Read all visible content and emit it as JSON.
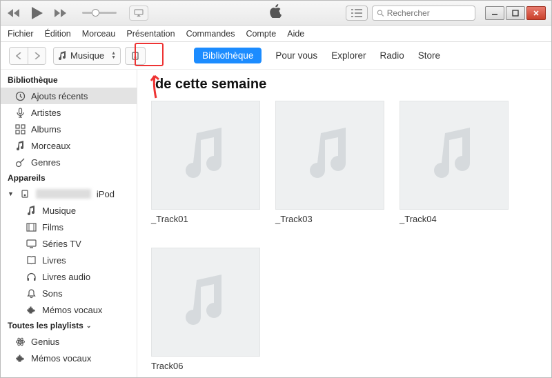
{
  "search": {
    "placeholder": "Rechercher"
  },
  "menubar": [
    "Fichier",
    "Édition",
    "Morceau",
    "Présentation",
    "Commandes",
    "Compte",
    "Aide"
  ],
  "subbar": {
    "media_label": "Musique"
  },
  "tabs": [
    {
      "label": "Bibliothèque",
      "active": true
    },
    {
      "label": "Pour vous",
      "active": false
    },
    {
      "label": "Explorer",
      "active": false
    },
    {
      "label": "Radio",
      "active": false
    },
    {
      "label": "Store",
      "active": false
    }
  ],
  "sidebar": {
    "library_header": "Bibliothèque",
    "library_items": [
      {
        "icon": "clock",
        "label": "Ajouts récents",
        "selected": true
      },
      {
        "icon": "mic",
        "label": "Artistes"
      },
      {
        "icon": "grid",
        "label": "Albums"
      },
      {
        "icon": "note",
        "label": "Morceaux"
      },
      {
        "icon": "guitar",
        "label": "Genres"
      }
    ],
    "devices_header": "Appareils",
    "device_name_suffix": "iPod",
    "device_items": [
      {
        "icon": "note",
        "label": "Musique"
      },
      {
        "icon": "film",
        "label": "Films"
      },
      {
        "icon": "tv",
        "label": "Séries TV"
      },
      {
        "icon": "book",
        "label": "Livres"
      },
      {
        "icon": "headphones",
        "label": "Livres audio"
      },
      {
        "icon": "bell",
        "label": "Sons"
      },
      {
        "icon": "wave",
        "label": "Mémos vocaux"
      }
    ],
    "playlists_header": "Toutes les playlists",
    "playlist_items": [
      {
        "icon": "atom",
        "label": "Genius"
      },
      {
        "icon": "wave",
        "label": "Mémos vocaux"
      }
    ]
  },
  "main": {
    "section_title": "de cette semaine",
    "albums": [
      {
        "label": "_Track01"
      },
      {
        "label": "_Track03"
      },
      {
        "label": "_Track04"
      },
      {
        "label": "Track06"
      }
    ]
  }
}
